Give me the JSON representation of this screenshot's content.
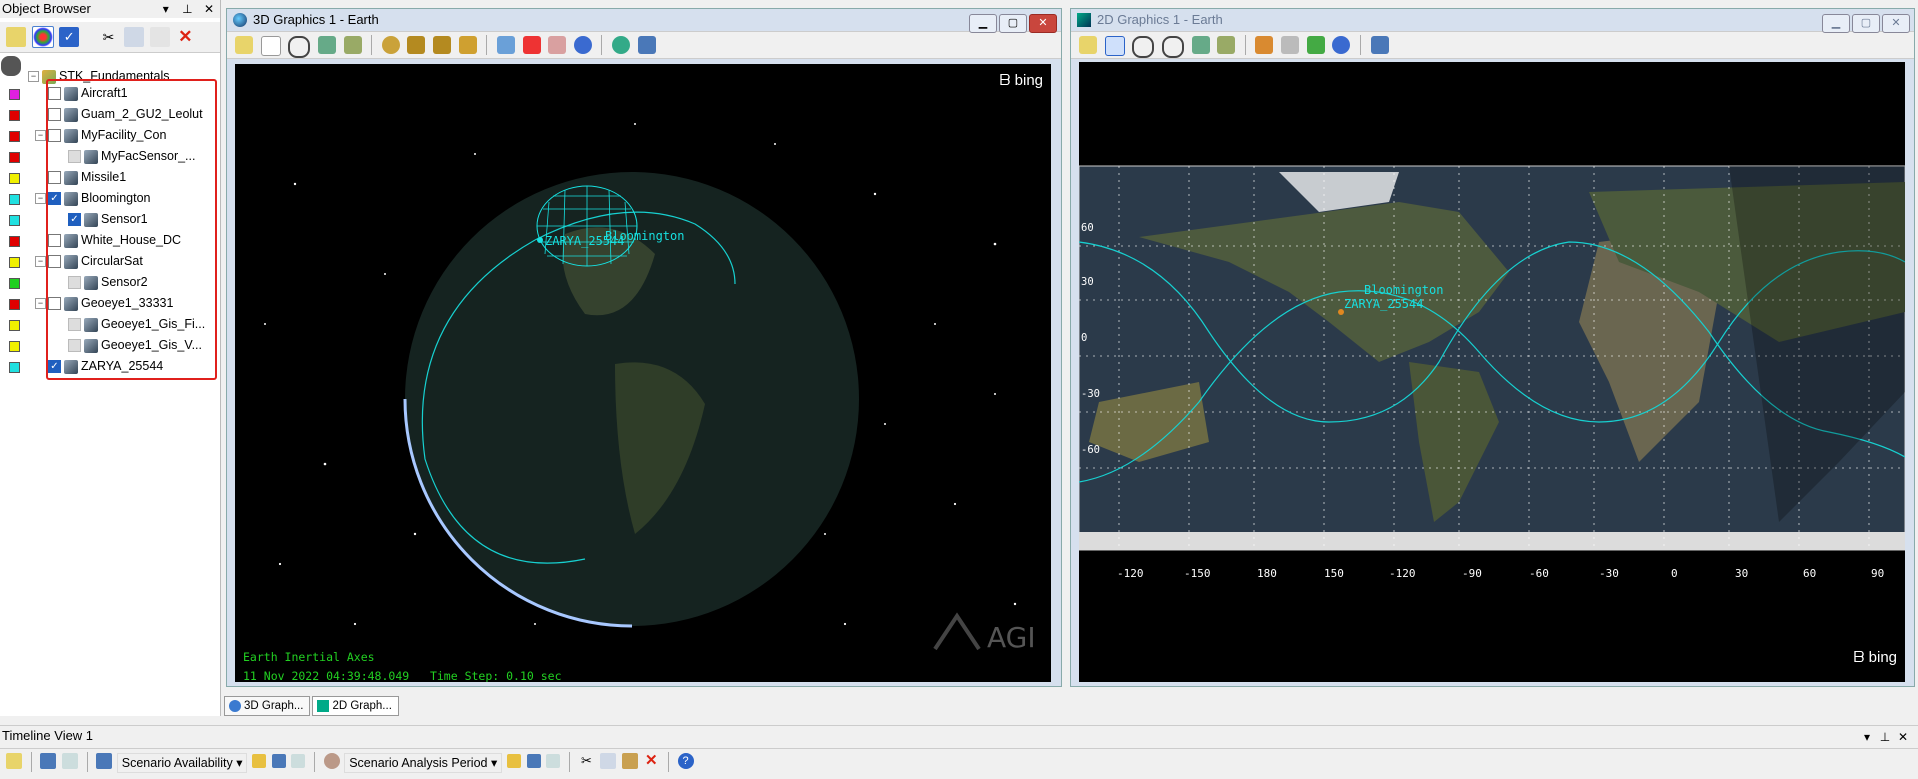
{
  "object_browser": {
    "title": "Object Browser",
    "title_buttons": [
      "▾",
      "⊥",
      "✕"
    ],
    "root": "STK_Fundamentals",
    "items": [
      {
        "label": "Aircraft1",
        "color": "#e020e0",
        "checked": false,
        "level": 1
      },
      {
        "label": "Guam_2_GU2_Leolut",
        "color": "#e00000",
        "checked": false,
        "level": 1
      },
      {
        "label": "MyFacility_Con",
        "color": "#e00000",
        "checked": false,
        "level": 1,
        "expander": "−"
      },
      {
        "label": "MyFacSensor_...",
        "color": "#e00000",
        "checked": false,
        "level": 2,
        "disabled": true
      },
      {
        "label": "Missile1",
        "color": "#f0f000",
        "checked": false,
        "level": 1
      },
      {
        "label": "Bloomington",
        "color": "#20e0e0",
        "checked": true,
        "level": 1,
        "expander": "−"
      },
      {
        "label": "Sensor1",
        "color": "#20e0e0",
        "checked": true,
        "level": 2
      },
      {
        "label": "White_House_DC",
        "color": "#e00000",
        "checked": false,
        "level": 1
      },
      {
        "label": "CircularSat",
        "color": "#f0f000",
        "checked": false,
        "level": 1,
        "expander": "−"
      },
      {
        "label": "Sensor2",
        "color": "#20d020",
        "checked": false,
        "level": 2,
        "disabled": true
      },
      {
        "label": "Geoeye1_33331",
        "color": "#e00000",
        "checked": false,
        "level": 1,
        "expander": "−"
      },
      {
        "label": "Geoeye1_Gis_Fi...",
        "color": "#f0f000",
        "checked": false,
        "level": 2,
        "disabled": true
      },
      {
        "label": "Geoeye1_Gis_V...",
        "color": "#f0f000",
        "checked": false,
        "level": 2,
        "disabled": true
      },
      {
        "label": "ZARYA_25544",
        "color": "#20e0e0",
        "checked": true,
        "level": 1
      }
    ]
  },
  "window_3d": {
    "title": "3D Graphics 1 - Earth",
    "bing": "bing",
    "agi": "AGI",
    "axes_text": "Earth Inertial Axes",
    "datetime": "11 Nov 2022 04:39:48.049",
    "timestep": "Time Step: 0.10 sec",
    "label_zarya": "ZARYA_25544",
    "label_bloomington": "Bloomington"
  },
  "window_2d": {
    "title": "2D Graphics 1 - Earth",
    "bing": "bing",
    "lat_labels": [
      "60",
      "30",
      "0",
      "-30",
      "-60"
    ],
    "lon_labels": [
      "-120",
      "-150",
      "180",
      "150",
      "-120",
      "-90",
      "-60",
      "-30",
      "0",
      "30",
      "60",
      "90"
    ],
    "label_zarya": "ZARYA_25544",
    "label_bloomington": "Bloomington"
  },
  "tabs": [
    "3D Graph...",
    "2D Graph..."
  ],
  "timeline": {
    "title": "Timeline View 1",
    "availability": "Scenario Availability",
    "analysis": "Scenario Analysis Period"
  }
}
